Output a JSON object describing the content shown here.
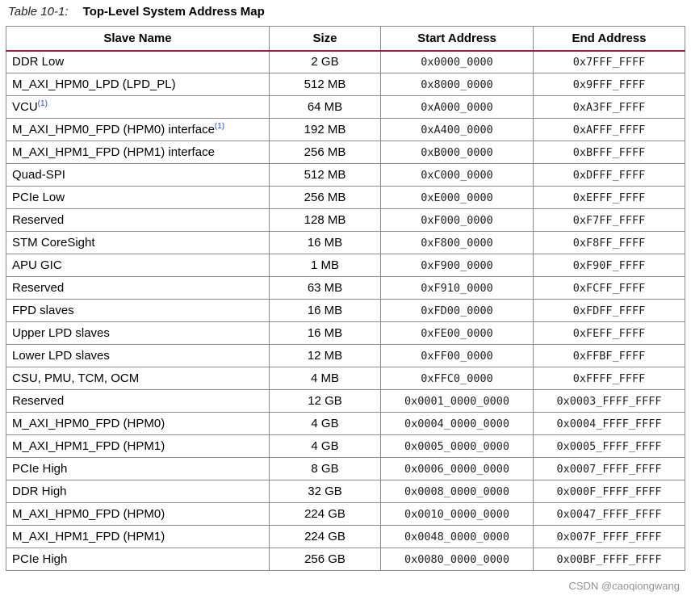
{
  "caption": {
    "label": "Table 10-1:",
    "title": "Top-Level System Address Map"
  },
  "table": {
    "headers": [
      "Slave Name",
      "Size",
      "Start Address",
      "End Address"
    ],
    "rows": [
      {
        "name": "DDR Low",
        "footnote": "",
        "size": "2 GB",
        "start": "0x0000_0000",
        "end": "0x7FFF_FFFF"
      },
      {
        "name": "M_AXI_HPM0_LPD (LPD_PL)",
        "footnote": "",
        "size": "512 MB",
        "start": "0x8000_0000",
        "end": "0x9FFF_FFFF"
      },
      {
        "name": "VCU",
        "footnote": "(1)",
        "size": "64 MB",
        "start": "0xA000_0000",
        "end": "0xA3FF_FFFF"
      },
      {
        "name": "M_AXI_HPM0_FPD (HPM0) interface",
        "footnote": "(1)",
        "size": "192 MB",
        "start": "0xA400_0000",
        "end": "0xAFFF_FFFF"
      },
      {
        "name": "M_AXI_HPM1_FPD (HPM1) interface",
        "footnote": "",
        "size": "256 MB",
        "start": "0xB000_0000",
        "end": "0xBFFF_FFFF"
      },
      {
        "name": "Quad-SPI",
        "footnote": "",
        "size": "512 MB",
        "start": "0xC000_0000",
        "end": "0xDFFF_FFFF"
      },
      {
        "name": "PCIe Low",
        "footnote": "",
        "size": "256 MB",
        "start": "0xE000_0000",
        "end": "0xEFFF_FFFF"
      },
      {
        "name": "Reserved",
        "footnote": "",
        "size": "128 MB",
        "start": "0xF000_0000",
        "end": "0xF7FF_FFFF"
      },
      {
        "name": "STM CoreSight",
        "footnote": "",
        "size": "16 MB",
        "start": "0xF800_0000",
        "end": "0xF8FF_FFFF"
      },
      {
        "name": "APU GIC",
        "footnote": "",
        "size": "1 MB",
        "start": "0xF900_0000",
        "end": "0xF90F_FFFF"
      },
      {
        "name": "Reserved",
        "footnote": "",
        "size": "63 MB",
        "start": "0xF910_0000",
        "end": "0xFCFF_FFFF"
      },
      {
        "name": "FPD slaves",
        "footnote": "",
        "size": "16 MB",
        "start": "0xFD00_0000",
        "end": "0xFDFF_FFFF"
      },
      {
        "name": "Upper LPD slaves",
        "footnote": "",
        "size": "16 MB",
        "start": "0xFE00_0000",
        "end": "0xFEFF_FFFF"
      },
      {
        "name": "Lower LPD slaves",
        "footnote": "",
        "size": "12 MB",
        "start": "0xFF00_0000",
        "end": "0xFFBF_FFFF"
      },
      {
        "name": "CSU, PMU, TCM, OCM",
        "footnote": "",
        "size": "4 MB",
        "start": "0xFFC0_0000",
        "end": "0xFFFF_FFFF"
      },
      {
        "name": "Reserved",
        "footnote": "",
        "size": "12 GB",
        "start": "0x0001_0000_0000",
        "end": "0x0003_FFFF_FFFF"
      },
      {
        "name": "M_AXI_HPM0_FPD (HPM0)",
        "footnote": "",
        "size": "4 GB",
        "start": "0x0004_0000_0000",
        "end": "0x0004_FFFF_FFFF"
      },
      {
        "name": "M_AXI_HPM1_FPD (HPM1)",
        "footnote": "",
        "size": "4 GB",
        "start": "0x0005_0000_0000",
        "end": "0x0005_FFFF_FFFF"
      },
      {
        "name": "PCIe High",
        "footnote": "",
        "size": "8 GB",
        "start": "0x0006_0000_0000",
        "end": "0x0007_FFFF_FFFF"
      },
      {
        "name": "DDR High",
        "footnote": "",
        "size": "32 GB",
        "start": "0x0008_0000_0000",
        "end": "0x000F_FFFF_FFFF"
      },
      {
        "name": "M_AXI_HPM0_FPD (HPM0)",
        "footnote": "",
        "size": "224 GB",
        "start": "0x0010_0000_0000",
        "end": "0x0047_FFFF_FFFF"
      },
      {
        "name": "M_AXI_HPM1_FPD (HPM1)",
        "footnote": "",
        "size": "224 GB",
        "start": "0x0048_0000_0000",
        "end": "0x007F_FFFF_FFFF"
      },
      {
        "name": "PCIe High",
        "footnote": "",
        "size": "256 GB",
        "start": "0x0080_0000_0000",
        "end": "0x00BF_FFFF_FFFF"
      }
    ]
  },
  "watermark": "CSDN @caoqiongwang",
  "colors": {
    "header_rule": "#a3193a",
    "grid": "#8a8a8a",
    "footnote": "#1f4fb4"
  }
}
